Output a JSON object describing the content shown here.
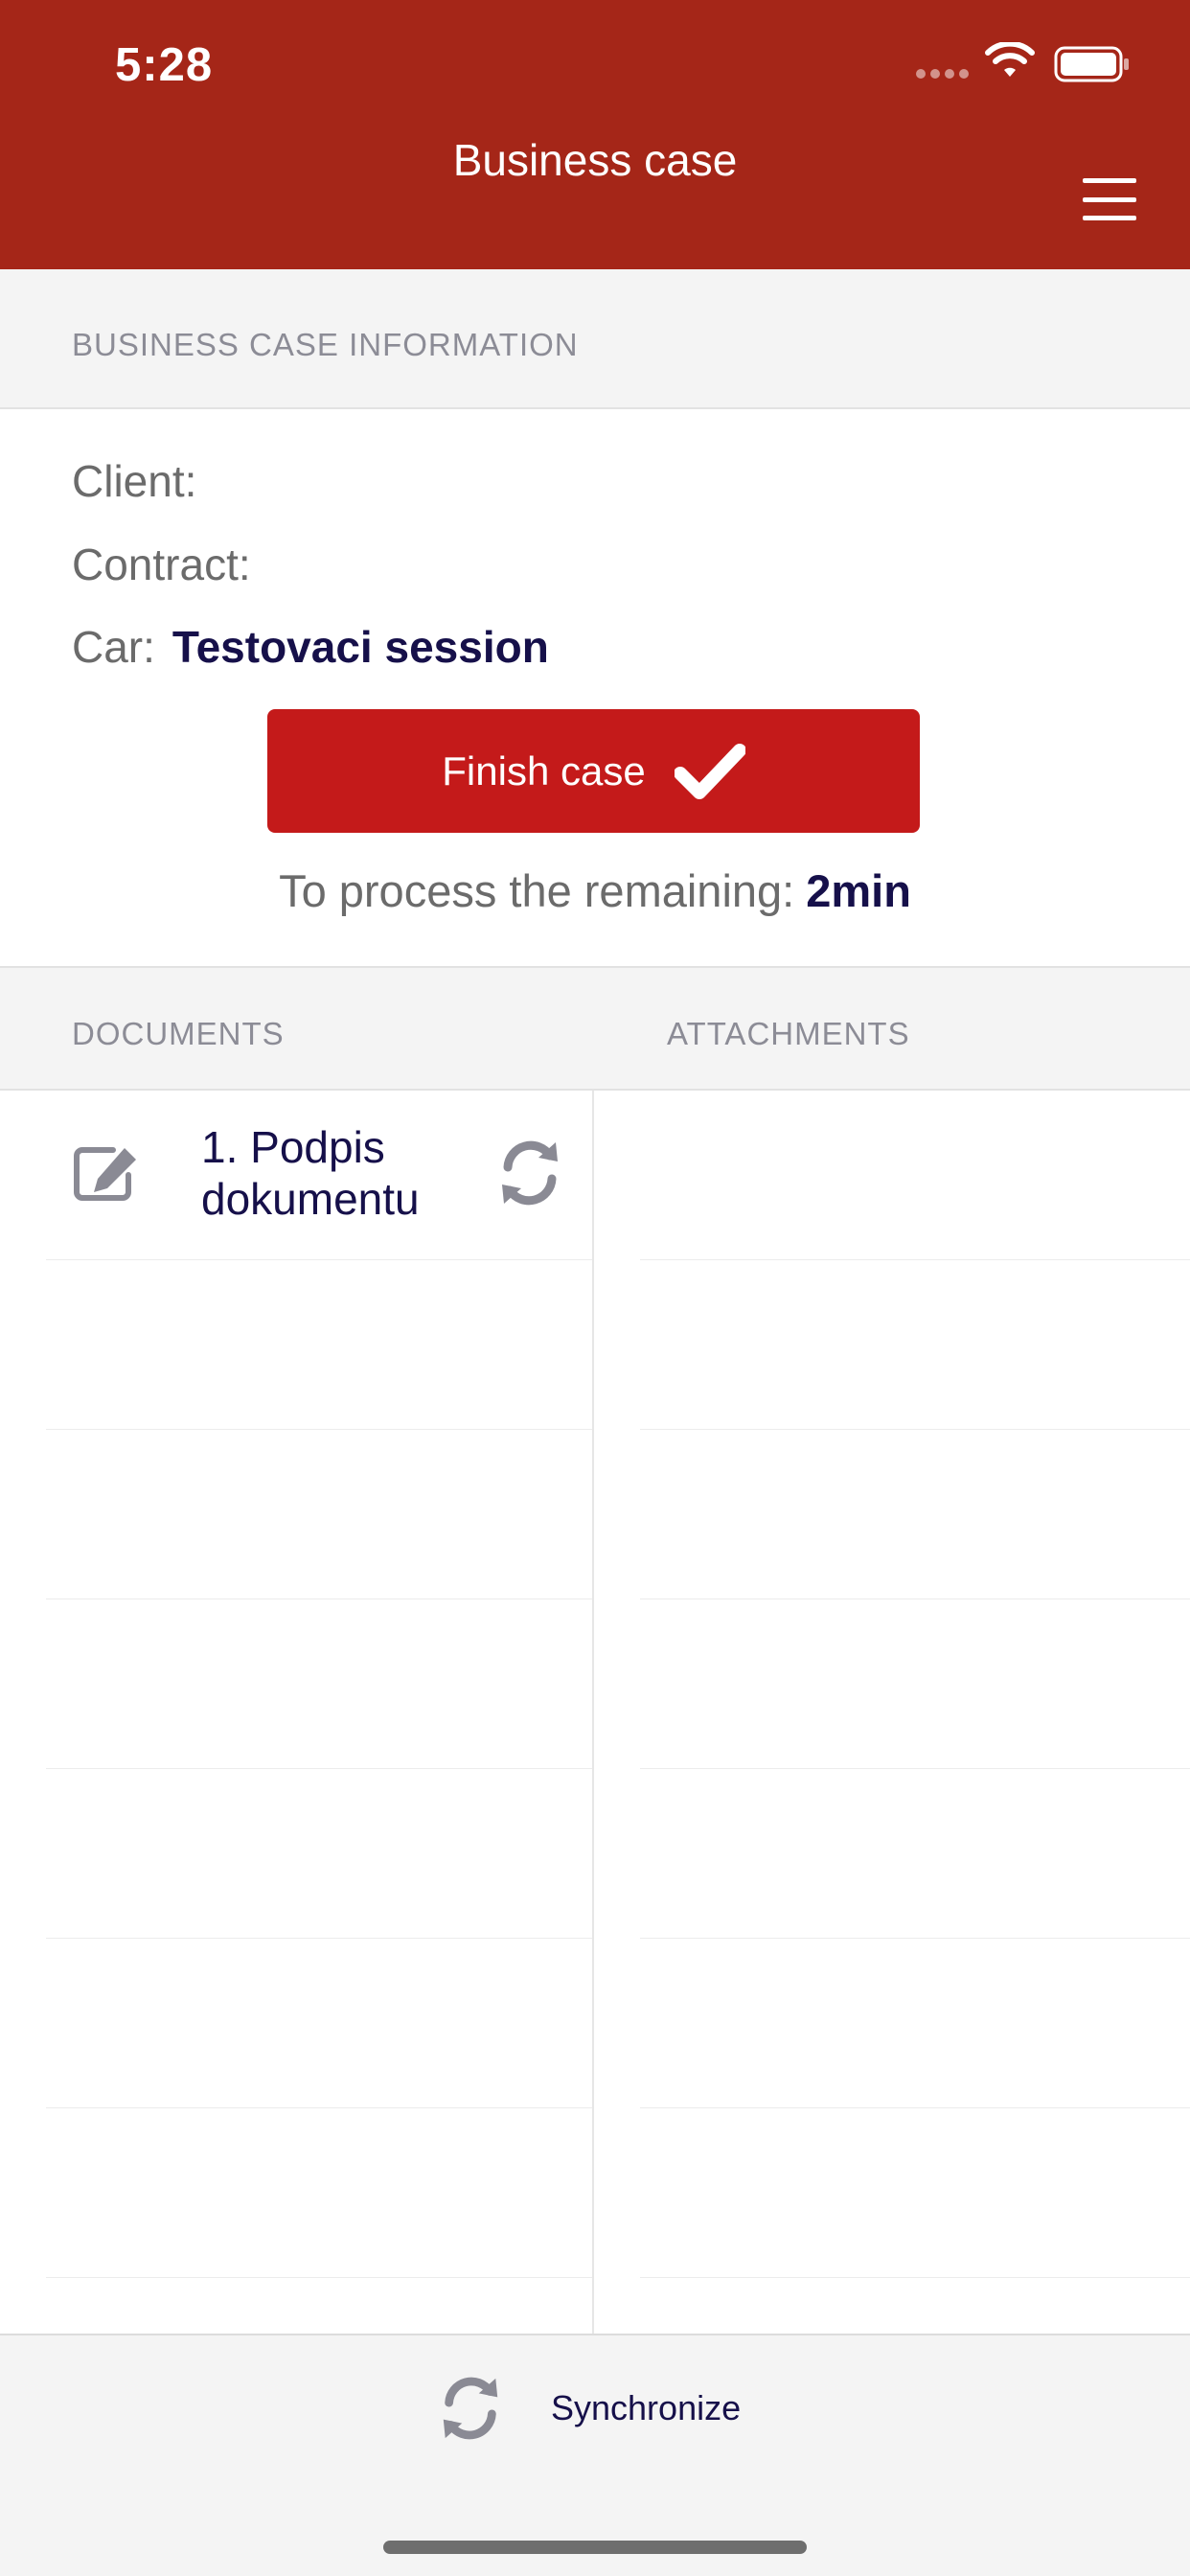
{
  "status_bar": {
    "time": "5:28"
  },
  "header": {
    "title": "Business case",
    "menu_icon": "hamburger-menu-icon"
  },
  "info_section": {
    "heading": "BUSINESS CASE INFORMATION",
    "client_label": "Client:",
    "client_value": "",
    "contract_label": "Contract:",
    "contract_value": "",
    "car_label": "Car:",
    "car_value": "Testovaci session",
    "finish_button": "Finish case",
    "finish_icon": "checkmark-icon",
    "remaining_label": "To process the remaining:",
    "remaining_value": "2min"
  },
  "lists": {
    "documents_heading": "DOCUMENTS",
    "attachments_heading": "ATTACHMENTS",
    "documents": [
      {
        "title": "1. Podpis dokumentu",
        "icon": "edit-icon",
        "action_icon": "sync-icon"
      }
    ],
    "attachments": []
  },
  "footer": {
    "sync_label": "Synchronize",
    "sync_icon": "sync-icon"
  },
  "colors": {
    "header": "#a52618",
    "accent": "#c41a1a",
    "value_text": "#16104a"
  }
}
